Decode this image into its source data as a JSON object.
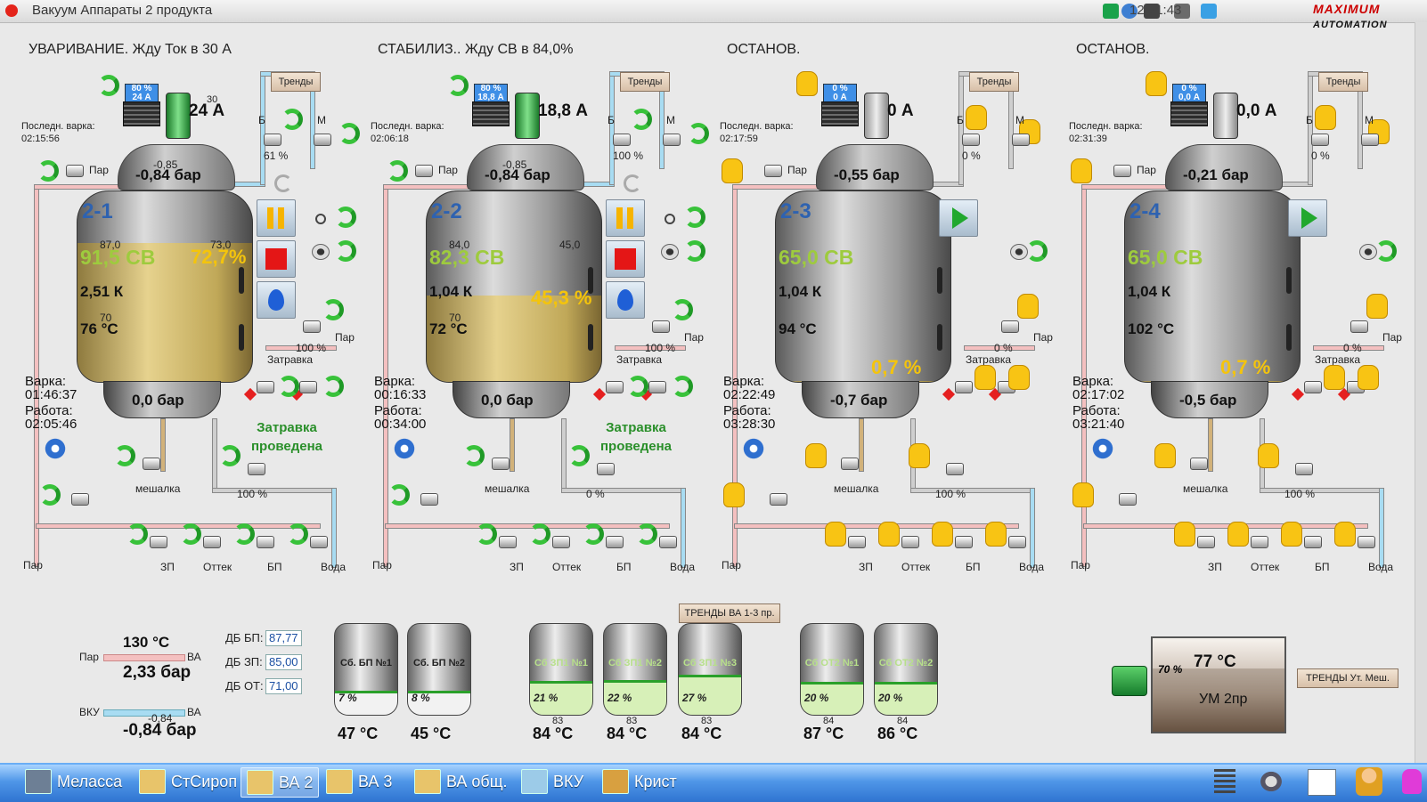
{
  "window": {
    "title": "Вакуум Аппараты 2 продукта",
    "clock": "12:21:43",
    "logo_main": "MAXIMUM",
    "logo_sub": "AUTOMATION"
  },
  "labels": {
    "trends": "Тренды",
    "last_cook": "Последн. варка:",
    "cook": "Варка:",
    "work": "Работа:",
    "steam": "Пар",
    "stirrer": "мешалка",
    "zapravka": "Затравка",
    "zp": "ЗП",
    "ottek": "Оттек",
    "bp": "БП",
    "water": "Вода",
    "b": "Б",
    "m": "М"
  },
  "tanks": [
    {
      "id": "2-1",
      "header": "УВАРИВАНИЕ. Жду Ток в 30 А",
      "last_cook_time": "02:15:56",
      "meter": [
        "80 %",
        "24 А"
      ],
      "current": "24 А",
      "current_sp": "30",
      "pressure_top": "-0,84 бар",
      "pressure_top_sp": "-0,85",
      "sv": "91,5 СВ",
      "sv_sp": "87,0",
      "level": "72,7%",
      "level_sp": "73,0",
      "level_fraction": 0.727,
      "k": "2,51 К",
      "temp": "76 °С",
      "temp_sp": "70",
      "steam_valve": "100 %",
      "top_valve_pct": "61 %",
      "bottom_pressure": "0,0 бар",
      "cook_time": "01:46:37",
      "work_time": "02:05:46",
      "discharge_pct": "100 %",
      "feed_pct": "",
      "zatravka_done": "Затравка проведена",
      "mode": "auto"
    },
    {
      "id": "2-2",
      "header": "СТАБИЛИЗ.. Жду СВ в 84,0%",
      "last_cook_time": "02:06:18",
      "meter": [
        "80 %",
        "18,8 А"
      ],
      "current": "18,8 А",
      "current_sp": "",
      "pressure_top": "-0,84 бар",
      "pressure_top_sp": "-0,85",
      "sv": "82,3 СВ",
      "sv_sp": "84,0",
      "level": "45,3 %",
      "level_sp": "45,0",
      "level_fraction": 0.453,
      "k": "1,04 К",
      "temp": "72 °С",
      "temp_sp": "70",
      "steam_valve": "100 %",
      "top_valve_pct": "100 %",
      "bottom_pressure": "0,0 бар",
      "cook_time": "00:16:33",
      "work_time": "00:34:00",
      "discharge_pct": "0 %",
      "feed_pct": "",
      "zatravka_done": "Затравка проведена",
      "mode": "auto"
    },
    {
      "id": "2-3",
      "header": "ОСТАНОВ.",
      "last_cook_time": "02:17:59",
      "meter": [
        "0 %",
        "0 А"
      ],
      "current": "0 А",
      "current_sp": "",
      "pressure_top": "-0,55 бар",
      "pressure_top_sp": "",
      "sv": "65,0 СВ",
      "sv_sp": "",
      "level": "0,7 %",
      "level_sp": "",
      "level_fraction": 0.007,
      "k": "1,04 К",
      "temp": "94 °С",
      "temp_sp": "",
      "steam_valve": "0 %",
      "top_valve_pct": "0 %",
      "bottom_pressure": "-0,7 бар",
      "cook_time": "02:22:49",
      "work_time": "03:28:30",
      "discharge_pct": "100 %",
      "feed_pct": "",
      "zatravka_done": "",
      "mode": "manual"
    },
    {
      "id": "2-4",
      "header": "ОСТАНОВ.",
      "last_cook_time": "02:31:39",
      "meter": [
        "0 %",
        "0,0 А"
      ],
      "current": "0,0 А",
      "current_sp": "",
      "pressure_top": "-0,21 бар",
      "pressure_top_sp": "",
      "sv": "65,0 СВ",
      "sv_sp": "",
      "level": "0,7 %",
      "level_sp": "",
      "level_fraction": 0.007,
      "k": "1,04 К",
      "temp": "102 °С",
      "temp_sp": "",
      "steam_valve": "0 %",
      "top_valve_pct": "0 %",
      "bottom_pressure": "-0,5 бар",
      "cook_time": "02:17:02",
      "work_time": "03:21:40",
      "discharge_pct": "100 %",
      "feed_pct": "",
      "zatravka_done": "",
      "mode": "manual"
    }
  ],
  "trends_button": "ТРЕНДЫ ВА 1-3 пр.",
  "trends_mixer_button": "ТРЕНДЫ Ут. Меш.",
  "steam_line": {
    "temp": "130 °С",
    "pressure": "2,33 бар",
    "left": "Пар",
    "right": "ВА"
  },
  "vku_line": {
    "left": "ВКУ",
    "right": "ВА",
    "small": "-0,84",
    "pressure": "-0,84 бар"
  },
  "db": [
    {
      "label": "ДБ БП:",
      "value": "87,77"
    },
    {
      "label": "ДБ ЗП:",
      "value": "85,00"
    },
    {
      "label": "ДБ ОТ:",
      "value": "71,00"
    }
  ],
  "bottom_tanks": [
    {
      "name": "Сб. БП №1",
      "pct": "7 %",
      "temp": "47 °С",
      "sp": "",
      "fraction": 0.07,
      "color": "#f2f2f2"
    },
    {
      "name": "Сб. БП №2",
      "pct": "8 %",
      "temp": "45 °С",
      "sp": "",
      "fraction": 0.08,
      "color": "#f2f2f2"
    },
    {
      "name": "Сб ЗП1 №1",
      "pct": "21 %",
      "temp": "84 °С",
      "sp": "83",
      "fraction": 0.21,
      "color": "#d7f0b8"
    },
    {
      "name": "Сб ЗП1 №2",
      "pct": "22 %",
      "temp": "84 °С",
      "sp": "83",
      "fraction": 0.22,
      "color": "#d7f0b8"
    },
    {
      "name": "Сб ЗП1 №3",
      "pct": "27 %",
      "temp": "84 °С",
      "sp": "83",
      "fraction": 0.27,
      "color": "#d7f0b8"
    },
    {
      "name": "Сб ОТ2 №1",
      "pct": "20 %",
      "temp": "87 °С",
      "sp": "84",
      "fraction": 0.2,
      "color": "#d7f0b8"
    },
    {
      "name": "Сб ОТ2 №2",
      "pct": "20 %",
      "temp": "86 °С",
      "sp": "84",
      "fraction": 0.2,
      "color": "#d7f0b8"
    }
  ],
  "mixer": {
    "pct": "70 %",
    "temp": "77 °С",
    "name": "УМ 2пр",
    "fraction": 0.7
  },
  "taskbar": [
    {
      "label": "Меласса",
      "active": false
    },
    {
      "label": "СтСироп",
      "active": false
    },
    {
      "label": "ВА 2",
      "active": true
    },
    {
      "label": "ВА 3",
      "active": false
    },
    {
      "label": "ВА общ.",
      "active": false
    },
    {
      "label": "ВКУ",
      "active": false
    },
    {
      "label": "Крист",
      "active": false
    }
  ],
  "colors": {
    "steam_pipe": "#f4c0c0",
    "water_pipe": "#a8dcf2",
    "massecuite": "#d8c27a",
    "refresh_green": "#38c23a",
    "hand_yellow": "#f8c414",
    "sv_green": "#9ecb3e",
    "level_yellow": "#f4c40c",
    "tank_id_blue": "#2e62b0"
  }
}
